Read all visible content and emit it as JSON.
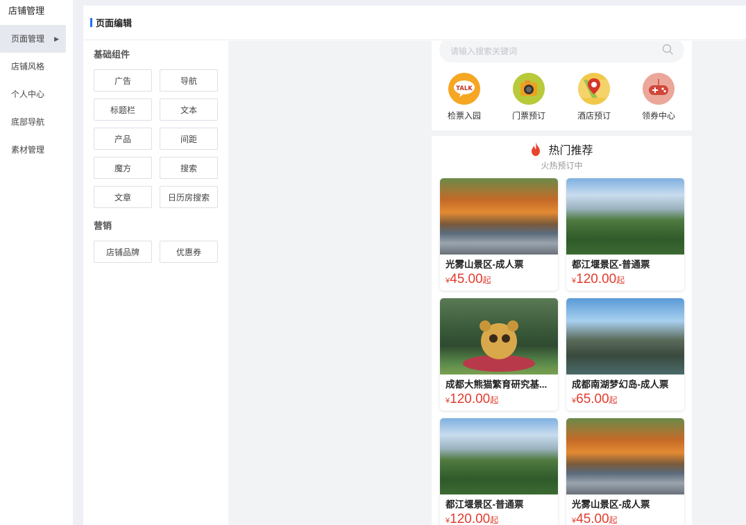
{
  "sidebar": {
    "title": "店铺管理",
    "items": [
      {
        "label": "页面管理",
        "active": true
      },
      {
        "label": "店铺风格"
      },
      {
        "label": "个人中心"
      },
      {
        "label": "底部导航"
      },
      {
        "label": "素材管理"
      }
    ]
  },
  "header": {
    "title": "页面编辑"
  },
  "components": {
    "basic": {
      "title": "基础组件",
      "items": [
        "广告",
        "导航",
        "标题栏",
        "文本",
        "产品",
        "间距",
        "魔方",
        "搜索",
        "文章",
        "日历房搜索"
      ]
    },
    "marketing": {
      "title": "营销",
      "items": [
        "店铺品牌",
        "优惠券"
      ]
    }
  },
  "preview": {
    "search": {
      "placeholder": "请输入搜索关键词"
    },
    "nav": [
      {
        "label": "检票入园",
        "icon": "talk-icon",
        "color": "#f5a623"
      },
      {
        "label": "门票预订",
        "icon": "camera-icon",
        "color": "#b8c93a"
      },
      {
        "label": "酒店预订",
        "icon": "map-pin-icon",
        "color": "#f2c84b"
      },
      {
        "label": "领券中心",
        "icon": "gamepad-icon",
        "color": "#eba79a"
      }
    ],
    "hot": {
      "title": "热门推荐",
      "subtitle": "火热预订中"
    },
    "products": [
      {
        "name": "光雾山景区-成人票",
        "price": "45.00",
        "currency": "¥",
        "suffix": "起",
        "image": "autumn"
      },
      {
        "name": "都江堰景区-普通票",
        "price": "120.00",
        "currency": "¥",
        "suffix": "起",
        "image": "tower"
      },
      {
        "name": "成都大熊猫繁育研究基...",
        "price": "120.00",
        "currency": "¥",
        "suffix": "起",
        "image": "panda"
      },
      {
        "name": "成都南湖梦幻岛-成人票",
        "price": "65.00",
        "currency": "¥",
        "suffix": "起",
        "image": "island"
      },
      {
        "name": "都江堰景区-普通票",
        "price": "120.00",
        "currency": "¥",
        "suffix": "起",
        "image": "tower"
      },
      {
        "name": "光雾山景区-成人票",
        "price": "45.00",
        "currency": "¥",
        "suffix": "起",
        "image": "autumn"
      }
    ]
  },
  "colors": {
    "accent": "#1f6fff",
    "price": "#e23b2e",
    "fire": "#e8452e"
  }
}
